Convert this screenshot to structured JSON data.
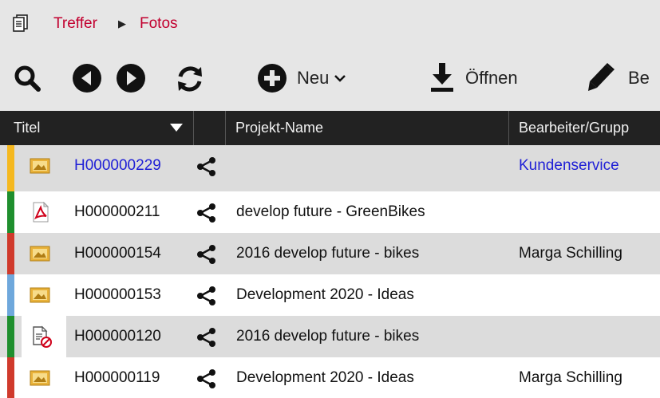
{
  "breadcrumb": {
    "icon": "documents-icon",
    "items": [
      "Treffer",
      "Fotos"
    ],
    "separator": "▶"
  },
  "toolbar": {
    "search_icon": "search-icon",
    "back_icon": "back-icon",
    "forward_icon": "forward-icon",
    "refresh_icon": "refresh-icon",
    "new_label": "Neu",
    "open_label": "Öffnen",
    "edit_label": "Be"
  },
  "grid": {
    "columns": [
      "Titel",
      "Projekt-Name",
      "Bearbeiter/Grupp"
    ],
    "rows": [
      {
        "stripe": "#f5b81f",
        "type_icon": "image-icon",
        "id": "H000000229",
        "project": "",
        "editor": "Kundenservice",
        "id_link": true,
        "editor_link": true
      },
      {
        "stripe": "#1f8f2e",
        "type_icon": "pdf-icon",
        "id": "H000000211",
        "project": "develop future - GreenBikes",
        "editor": ""
      },
      {
        "stripe": "#d03a2c",
        "type_icon": "image-icon",
        "id": "H000000154",
        "project": "2016 develop future - bikes",
        "editor": "Marga Schilling"
      },
      {
        "stripe": "#6fa8dc",
        "type_icon": "image-icon",
        "id": "H000000153",
        "project": "Development 2020 - Ideas",
        "editor": ""
      },
      {
        "stripe": "#1f8f2e",
        "type_icon": "blocked-doc-icon",
        "id": "H000000120",
        "project": "2016 develop future - bikes",
        "editor": ""
      },
      {
        "stripe": "#d03a2c",
        "type_icon": "image-icon",
        "id": "H000000119",
        "project": "Development 2020 - Ideas",
        "editor": "Marga Schilling"
      }
    ]
  }
}
